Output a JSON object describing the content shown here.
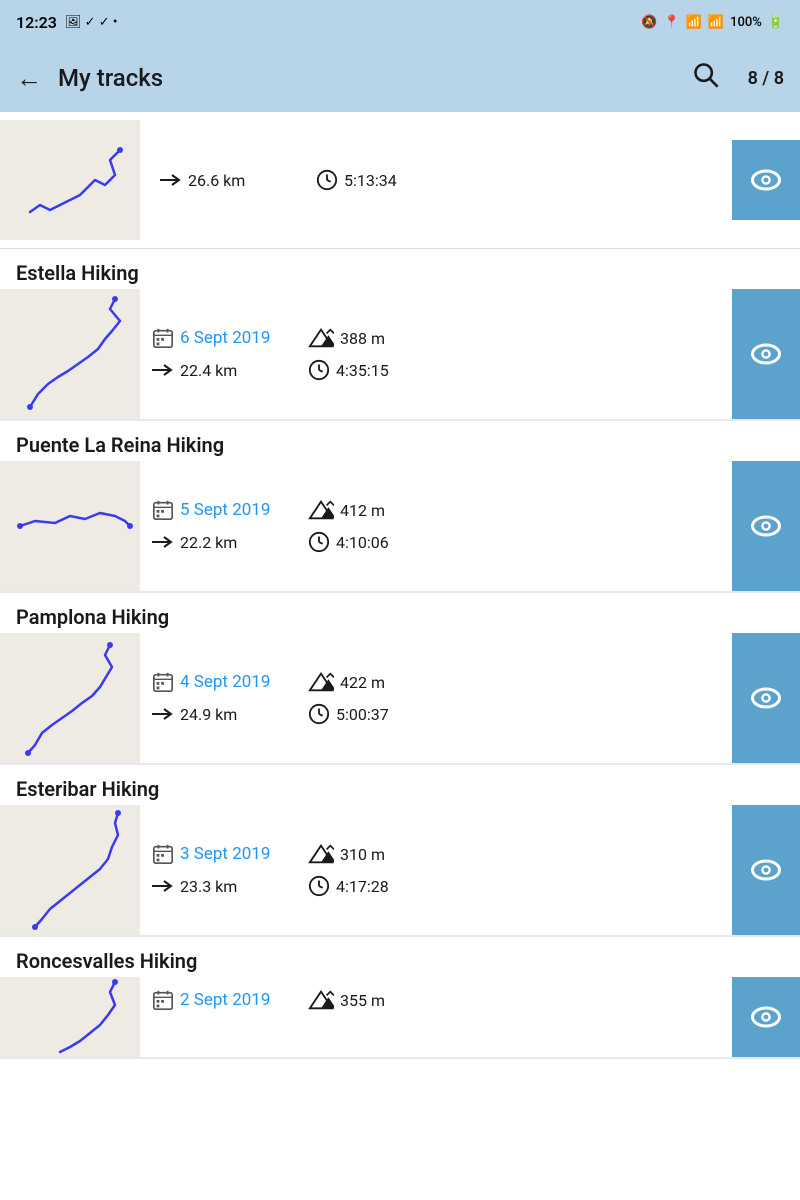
{
  "status": {
    "time": "12:23",
    "battery": "100%"
  },
  "header": {
    "title": "My tracks",
    "back_label": "←",
    "search_label": "🔍",
    "count": "8 / 8"
  },
  "partial_item": {
    "distance": "26.6 km",
    "duration": "5:13:34"
  },
  "tracks": [
    {
      "name": "Estella Hiking",
      "date": "6 Sept 2019",
      "elevation": "388 m",
      "distance": "22.4 km",
      "duration": "4:35:15"
    },
    {
      "name": "Puente La Reina Hiking",
      "date": "5 Sept 2019",
      "elevation": "412 m",
      "distance": "22.2 km",
      "duration": "4:10:06"
    },
    {
      "name": "Pamplona Hiking",
      "date": "4 Sept 2019",
      "elevation": "422 m",
      "distance": "24.9 km",
      "duration": "5:00:37"
    },
    {
      "name": "Esteribar Hiking",
      "date": "3 Sept 2019",
      "elevation": "310 m",
      "distance": "23.3 km",
      "duration": "4:17:28"
    },
    {
      "name": "Roncesvalles Hiking",
      "date": "2 Sept 2019",
      "elevation": "355 m",
      "distance": "",
      "duration": ""
    }
  ],
  "colors": {
    "header_bg": "#b8d4e8",
    "eye_bg": "#5ba3cc",
    "date_color": "#2196F3",
    "track_color": "#3a3aee"
  },
  "icons": {
    "back": "←",
    "search": "search-icon",
    "eye": "eye-icon",
    "calendar": "calendar-icon",
    "mountain": "mountain-icon",
    "arrow_right": "distance-arrow-icon",
    "clock": "clock-icon"
  }
}
